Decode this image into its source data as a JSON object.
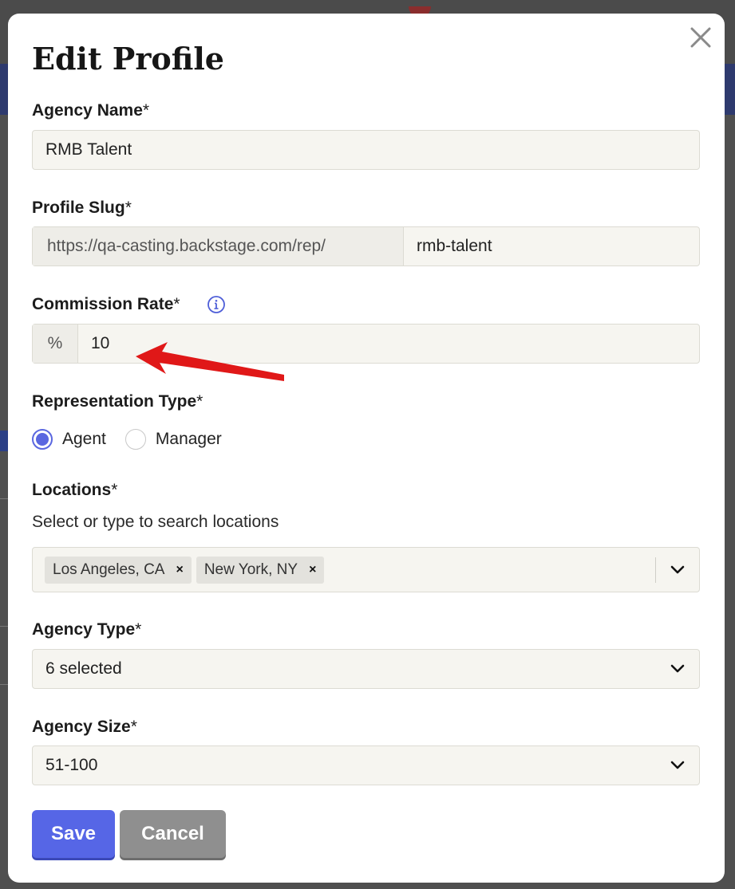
{
  "modal": {
    "title": "Edit Profile",
    "required_mark": "*"
  },
  "fields": {
    "agency_name": {
      "label": "Agency Name",
      "value": "RMB Talent"
    },
    "profile_slug": {
      "label": "Profile Slug",
      "prefix": "https://qa-casting.backstage.com/rep/",
      "value": "rmb-talent"
    },
    "commission_rate": {
      "label": "Commission Rate",
      "prefix": "%",
      "value": "10"
    },
    "representation_type": {
      "label": "Representation Type",
      "options": [
        {
          "label": "Agent",
          "selected": true
        },
        {
          "label": "Manager",
          "selected": false
        }
      ]
    },
    "locations": {
      "label": "Locations",
      "helper": "Select or type to search locations",
      "chips": [
        "Los Angeles, CA",
        "New York, NY"
      ],
      "chip_remove": "×"
    },
    "agency_type": {
      "label": "Agency Type",
      "value": "6 selected"
    },
    "agency_size": {
      "label": "Agency Size",
      "value": "51-100"
    }
  },
  "buttons": {
    "save": "Save",
    "cancel": "Cancel"
  },
  "colors": {
    "primary": "#5666e6",
    "cancel": "#8f8f8f",
    "input_bg": "#f6f5f0",
    "annotation_arrow": "#e01818"
  }
}
